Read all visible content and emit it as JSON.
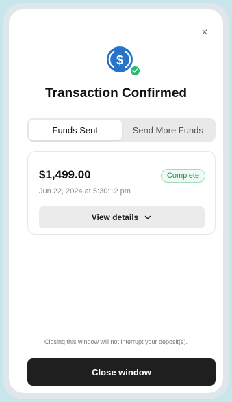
{
  "modal": {
    "close_glyph": "×",
    "title": "Transaction Confirmed",
    "icons": {
      "token": "usdc-dollar-coin-icon",
      "status": "check-circle-icon",
      "close": "close-icon",
      "expand": "chevron-down-icon"
    },
    "tabs": [
      {
        "label": "Funds Sent",
        "active": true
      },
      {
        "label": "Send More Funds",
        "active": false
      }
    ],
    "transaction": {
      "amount": "$1,499.00",
      "status": "Complete",
      "date": "Jun 22, 2024 at 5:30:12 pm",
      "details_label": "View details"
    },
    "footnote": "Closing this window will not interrupt your deposit(s).",
    "close_button_label": "Close window"
  },
  "colors": {
    "coin_blue": "#2775ca",
    "success_green": "#2bb673",
    "button_dark": "#1f1f1f",
    "background": "#c9e5ec"
  }
}
